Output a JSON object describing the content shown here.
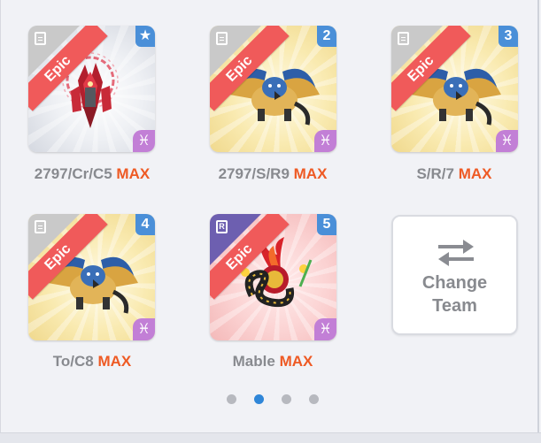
{
  "cards": [
    {
      "rarity": "Epic",
      "badge": "★",
      "element": "♓",
      "label": "2797/Cr/C5",
      "max": "MAX"
    },
    {
      "rarity": "Epic",
      "badge": "2",
      "element": "♓",
      "label": "2797/S/R9",
      "max": "MAX"
    },
    {
      "rarity": "Epic",
      "badge": "3",
      "element": "♓",
      "label": "S/R/7",
      "max": "MAX"
    },
    {
      "rarity": "Epic",
      "badge": "4",
      "element": "♓",
      "label": "To/C8",
      "max": "MAX"
    },
    {
      "rarity": "Epic",
      "badge": "5",
      "element": "♓",
      "label": "Mable",
      "max": "MAX",
      "corner_letter": "R"
    }
  ],
  "change_team": {
    "line1": "Change",
    "line2": "Team"
  },
  "pagination": {
    "current": 2,
    "total": 4
  },
  "colors": {
    "epic": "#f05a5a",
    "badge_blue": "#4a8fd8",
    "element_purple": "#c27fd6",
    "max": "#ee5a24",
    "active_dot": "#2f86d8"
  }
}
